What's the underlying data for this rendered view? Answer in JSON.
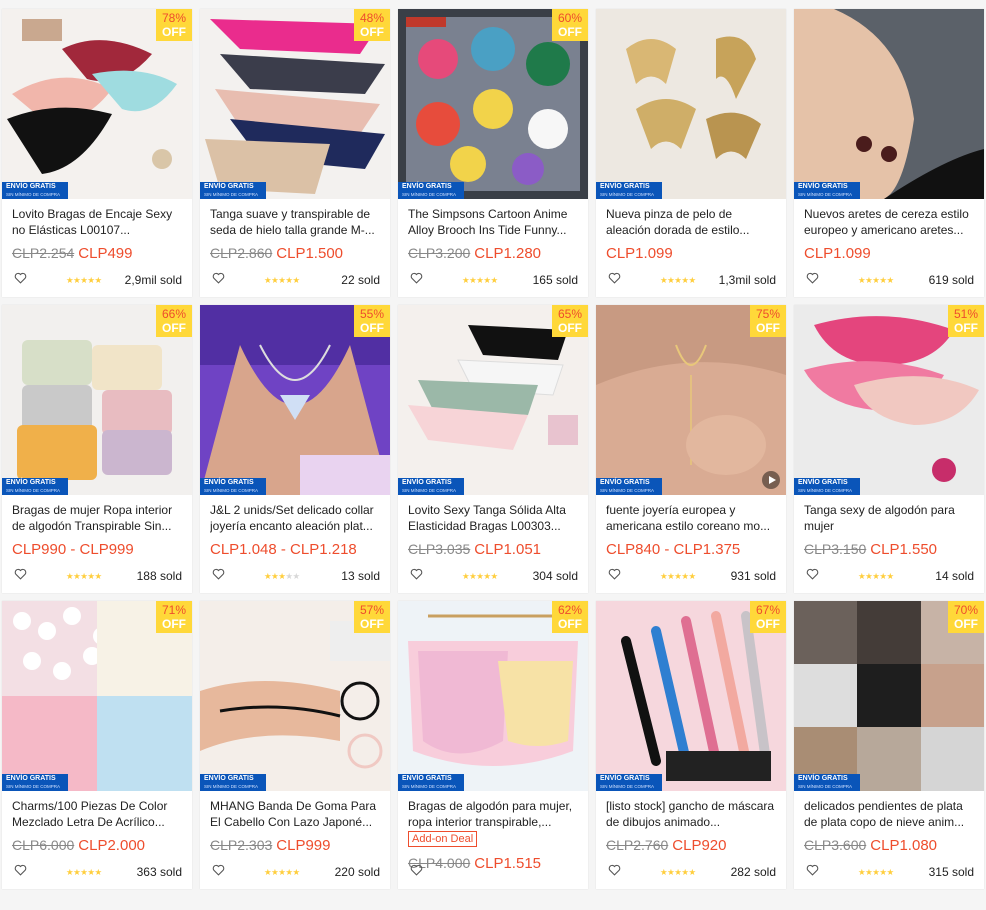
{
  "badge_off": "OFF",
  "shipping": {
    "line1": "ENVÍO GRATIS",
    "line2": "SIN MÍNIMO DE COMPRA"
  },
  "products": [
    {
      "title": "Lovito Bragas de Encaje Sexy no Elásticas L00107...",
      "orig": "CLP2.254",
      "price": "CLP499",
      "discount": "78%",
      "sold": "2,9mil sold",
      "rating": 5
    },
    {
      "title": "Tanga suave y transpirable de seda de hielo talla grande M-...",
      "orig": "CLP2.860",
      "price": "CLP1.500",
      "discount": "48%",
      "sold": "22 sold",
      "rating": 4.5
    },
    {
      "title": "The Simpsons Cartoon Anime Alloy Brooch Ins Tide Funny...",
      "orig": "CLP3.200",
      "price": "CLP1.280",
      "discount": "60%",
      "sold": "165 sold",
      "rating": 5
    },
    {
      "title": "Nueva pinza de pelo de aleación dorada de estilo...",
      "orig": "",
      "price": "CLP1.099",
      "discount": "",
      "sold": "1,3mil sold",
      "rating": 5
    },
    {
      "title": "Nuevos aretes de cereza estilo europeo y americano aretes...",
      "orig": "",
      "price": "CLP1.099",
      "discount": "",
      "sold": "619 sold",
      "rating": 4.5
    },
    {
      "title": "Bragas de mujer Ropa interior de algodón Transpirable Sin...",
      "orig": "",
      "price": "CLP990 - CLP999",
      "discount": "66%",
      "sold": "188 sold",
      "rating": 4.5
    },
    {
      "title": "J&L 2 unids/Set delicado collar joyería encanto aleación plat...",
      "orig": "",
      "price": "CLP1.048 - CLP1.218",
      "discount": "55%",
      "sold": "13 sold",
      "rating": 2.5
    },
    {
      "title": "Lovito Sexy Tanga Sólida Alta Elasticidad Bragas L00303...",
      "orig": "CLP3.035",
      "price": "CLP1.051",
      "discount": "65%",
      "sold": "304 sold",
      "rating": 5
    },
    {
      "title": "fuente joyería europea y americana estilo coreano mo...",
      "orig": "",
      "price": "CLP840 - CLP1.375",
      "discount": "75%",
      "sold": "931 sold",
      "rating": 4.5
    },
    {
      "title": "Tanga sexy de algodón para mujer",
      "orig": "CLP3.150",
      "price": "CLP1.550",
      "discount": "51%",
      "sold": "14 sold",
      "rating": 5
    },
    {
      "title": "Charms/100 Piezas De Color Mezclado Letra De Acrílico...",
      "orig": "CLP6.000",
      "price": "CLP2.000",
      "discount": "71%",
      "sold": "363 sold",
      "rating": 5
    },
    {
      "title": "MHANG Banda De Goma Para El Cabello Con Lazo Japoné...",
      "orig": "CLP2.303",
      "price": "CLP999",
      "discount": "57%",
      "sold": "220 sold",
      "rating": 5
    },
    {
      "title": "Bragas de algodón para mujer, ropa interior transpirable,...",
      "orig": "CLP4.000",
      "price": "CLP1.515",
      "discount": "62%",
      "sold": "",
      "rating": 0,
      "addon": "Add-on Deal"
    },
    {
      "title": "[listo stock] gancho de máscara de dibujos animado...",
      "orig": "CLP2.760",
      "price": "CLP920",
      "discount": "67%",
      "sold": "282 sold",
      "rating": 4.5
    },
    {
      "title": "delicados pendientes de plata de plata copo de nieve anim...",
      "orig": "CLP3.600",
      "price": "CLP1.080",
      "discount": "70%",
      "sold": "315 sold",
      "rating": 4.5
    }
  ],
  "colors": {
    "accent": "#ee4d2d",
    "badge": "#ffd839",
    "shipping": "#0a55b9",
    "star": "#ffce3d"
  },
  "icons": {
    "like": "heart-outline-icon",
    "rating": "star-icon",
    "video": "play-icon"
  }
}
